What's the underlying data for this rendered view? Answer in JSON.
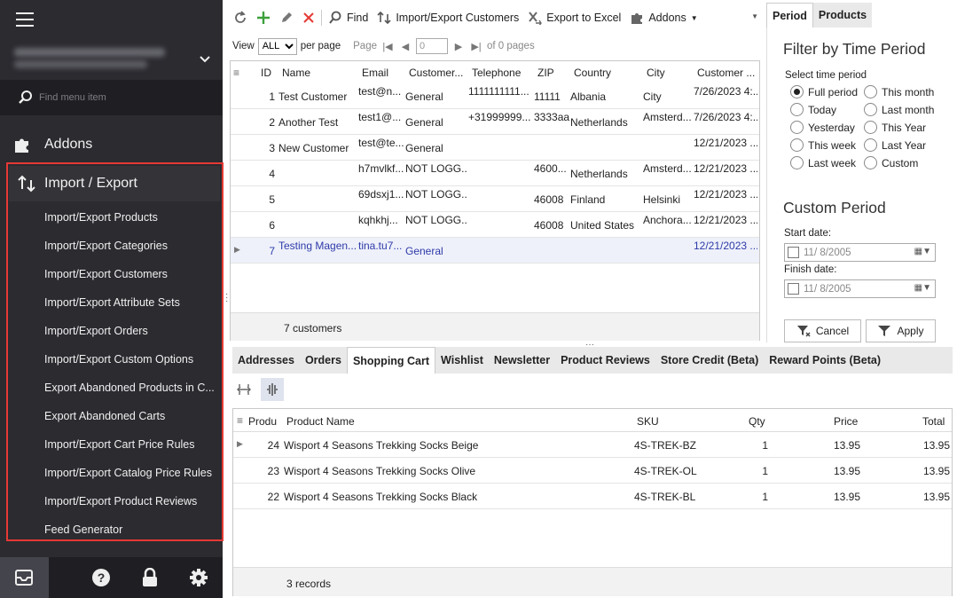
{
  "sidebar": {
    "search_placeholder": "Find menu item",
    "addons_label": "Addons",
    "import_export_label": "Import / Export",
    "items": [
      {
        "label": "Import/Export Products"
      },
      {
        "label": "Import/Export Categories"
      },
      {
        "label": "Import/Export Customers"
      },
      {
        "label": "Import/Export Attribute Sets"
      },
      {
        "label": "Import/Export Orders"
      },
      {
        "label": "Import/Export Custom Options"
      },
      {
        "label": "Export Abandoned Products in C..."
      },
      {
        "label": "Export Abandoned Carts"
      },
      {
        "label": "Import/Export Cart Price Rules"
      },
      {
        "label": "Import/Export Catalog Price Rules"
      },
      {
        "label": "Import/Export Product Reviews"
      },
      {
        "label": "Feed Generator"
      }
    ],
    "highlight_color": "#e53935"
  },
  "toolbar": {
    "find": "Find",
    "import_export_customers": "Import/Export Customers",
    "export_excel": "Export to Excel",
    "addons": "Addons"
  },
  "pager": {
    "view_label": "View",
    "view_value": "ALL",
    "per_page": "per page",
    "page_label": "Page",
    "page_value": "0",
    "of_pages": "of 0 pages"
  },
  "customers": {
    "columns": [
      "ID",
      "Name",
      "Email",
      "Customer...",
      "Telephone",
      "ZIP",
      "Country",
      "City",
      "Customer ..."
    ],
    "rows": [
      {
        "id": "1",
        "name": "Test Customer",
        "email": "test@n...",
        "group": "General",
        "phone": "1111111111...",
        "zip": "11111",
        "country": "Albania",
        "city": "City",
        "date": "7/26/2023 4:..."
      },
      {
        "id": "2",
        "name": "Another Test",
        "email": "test1@...",
        "group": "General",
        "phone": "+31999999...",
        "zip": "3333aa",
        "country": "Netherlands",
        "city": "Amsterd...",
        "date": "7/26/2023 4:..."
      },
      {
        "id": "3",
        "name": "New Customer",
        "email": "test@te...",
        "group": "General",
        "phone": "",
        "zip": "",
        "country": "",
        "city": "",
        "date": "12/21/2023 ..."
      },
      {
        "id": "4",
        "name": "",
        "email": "h7mvlkf...",
        "group": "NOT LOGG...",
        "phone": "",
        "zip": "4600...",
        "country": "Netherlands",
        "city": "Amsterd...",
        "date": "12/21/2023 ..."
      },
      {
        "id": "5",
        "name": "",
        "email": "69dsxj1...",
        "group": "NOT LOGG...",
        "phone": "",
        "zip": "46008",
        "country": "Finland",
        "city": "Helsinki",
        "date": "12/21/2023 ..."
      },
      {
        "id": "6",
        "name": "",
        "email": "kqhkhj...",
        "group": "NOT LOGG...",
        "phone": "",
        "zip": "46008",
        "country": "United States",
        "city": "Anchora...",
        "date": "12/21/2023 ..."
      },
      {
        "id": "7",
        "name": "Testing Magen...",
        "email": "tina.tu7...",
        "group": "General",
        "phone": "",
        "zip": "",
        "country": "",
        "city": "",
        "date": "12/21/2023 ..."
      }
    ],
    "footer": "7 customers"
  },
  "right_panel": {
    "tabs": [
      "Period",
      "Products"
    ],
    "title": "Filter by Time Period",
    "select_label": "Select time period",
    "options": [
      "Full period",
      "Today",
      "Yesterday",
      "This week",
      "Last week",
      "This month",
      "Last month",
      "This Year",
      "Last Year",
      "Custom"
    ],
    "selected": "Full period",
    "custom_title": "Custom Period",
    "start_label": "Start date:",
    "start_value": "11/  8/2005",
    "finish_label": "Finish date:",
    "finish_value": "11/  8/2005",
    "cancel": "Cancel",
    "apply": "Apply"
  },
  "detail": {
    "tabs": [
      "Addresses",
      "Orders",
      "Shopping Cart",
      "Wishlist",
      "Newsletter",
      "Product Reviews",
      "Store Credit (Beta)",
      "Reward Points (Beta)"
    ],
    "active_tab": "Shopping Cart",
    "columns": [
      "Produ",
      "Product Name",
      "SKU",
      "Qty",
      "Price",
      "Total"
    ],
    "rows": [
      {
        "id": "24",
        "name": "Wisport 4 Seasons Trekking Socks Beige",
        "sku": "4S-TREK-BZ",
        "qty": "1",
        "price": "13.95",
        "total": "13.95"
      },
      {
        "id": "23",
        "name": "Wisport 4 Seasons Trekking Socks Olive",
        "sku": "4S-TREK-OL",
        "qty": "1",
        "price": "13.95",
        "total": "13.95"
      },
      {
        "id": "22",
        "name": "Wisport 4 Seasons Trekking Socks Black",
        "sku": "4S-TREK-BL",
        "qty": "1",
        "price": "13.95",
        "total": "13.95"
      }
    ],
    "footer": "3 records"
  }
}
